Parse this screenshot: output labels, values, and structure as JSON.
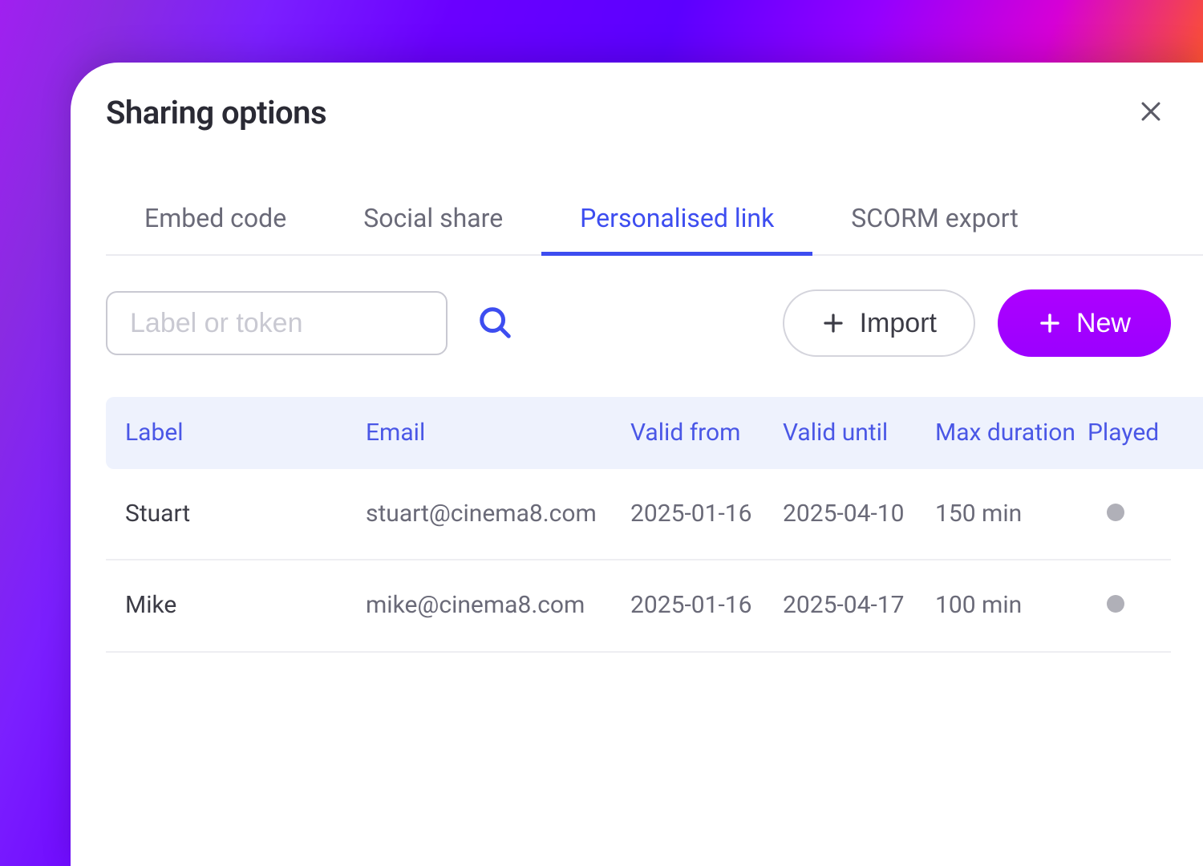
{
  "modal": {
    "title": "Sharing options"
  },
  "tabs": [
    {
      "label": "Embed code",
      "name": "tab-embed-code"
    },
    {
      "label": "Social share",
      "name": "tab-social-share"
    },
    {
      "label": "Personalised link",
      "name": "tab-personalised-link"
    },
    {
      "label": "SCORM export",
      "name": "tab-scorm-export"
    }
  ],
  "active_tab_index": 2,
  "search": {
    "placeholder": "Label or token",
    "value": ""
  },
  "buttons": {
    "import": "Import",
    "new": "New"
  },
  "table": {
    "columns": [
      "Label",
      "Email",
      "Valid from",
      "Valid until",
      "Max duration",
      "Played"
    ],
    "rows": [
      {
        "label": "Stuart",
        "email": "stuart@cinema8.com",
        "valid_from": "2025-01-16",
        "valid_until": "2025-04-10",
        "max_duration": "150 min",
        "played": false
      },
      {
        "label": "Mike",
        "email": "mike@cinema8.com",
        "valid_from": "2025-01-16",
        "valid_until": "2025-04-17",
        "max_duration": "100 min",
        "played": false
      }
    ]
  },
  "colors": {
    "accent_blue": "#3d4df0",
    "accent_purple": "#a100ff",
    "header_bg": "#eef2fd",
    "text_muted": "#6a6a78"
  }
}
